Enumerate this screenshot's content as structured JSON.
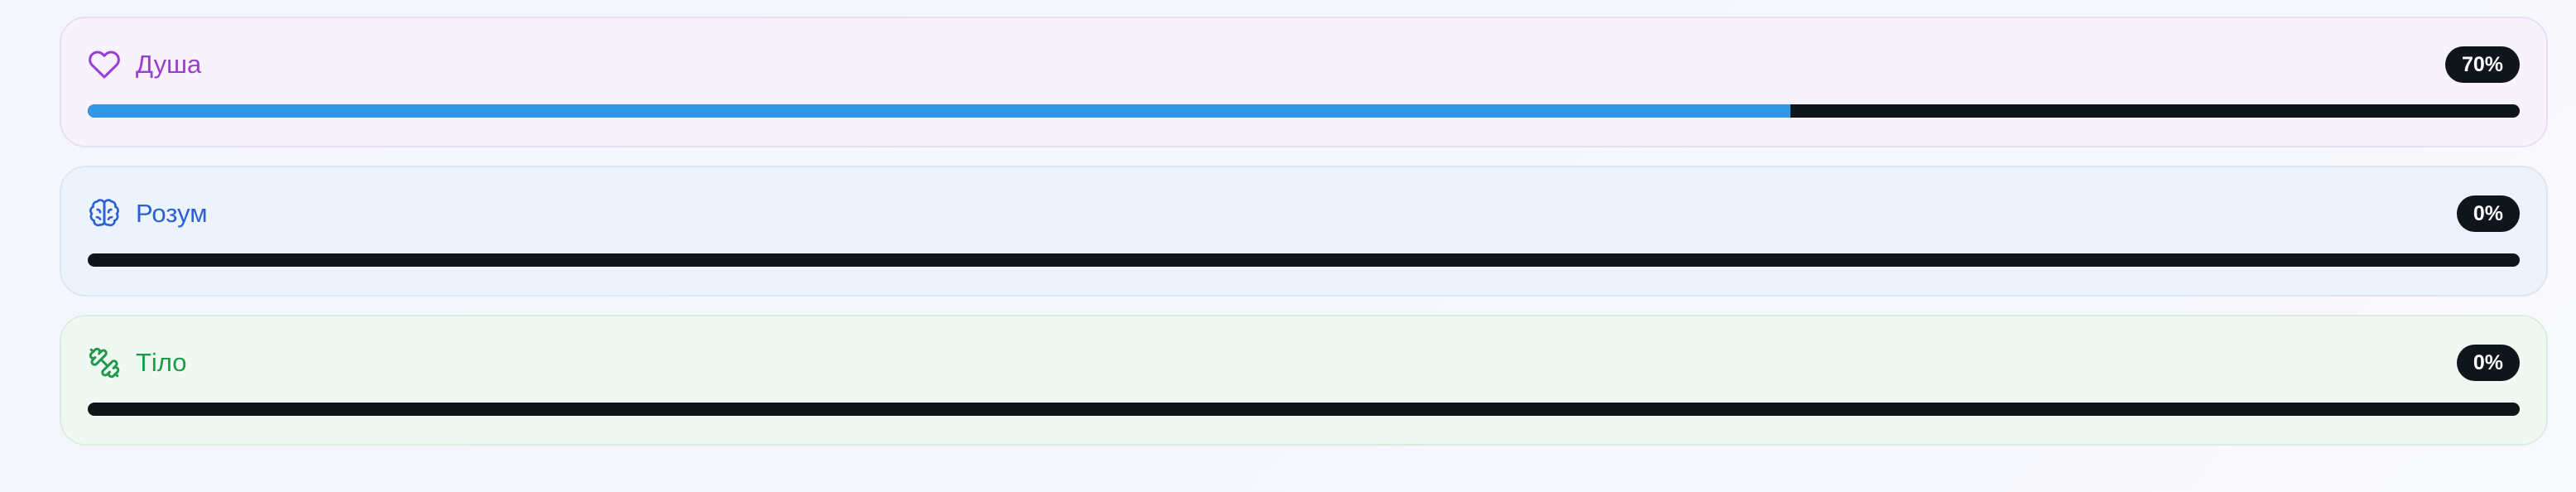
{
  "progress_items": [
    {
      "key": "soul",
      "label": "Душа",
      "percent_label": "70%",
      "progress": 0.7,
      "icon": "heart-icon",
      "color": "#9b3cd6"
    },
    {
      "key": "mind",
      "label": "Розум",
      "percent_label": "0%",
      "progress": 0.0,
      "icon": "brain-icon",
      "color": "#2a5fd6"
    },
    {
      "key": "body",
      "label": "Тіло",
      "percent_label": "0%",
      "progress": 0.0,
      "icon": "dumbbell-icon",
      "color": "#1e9a4a"
    }
  ],
  "colors": {
    "bar_fill": "#3297e4",
    "bar_track": "#10151c",
    "badge_bg": "#10151c"
  }
}
